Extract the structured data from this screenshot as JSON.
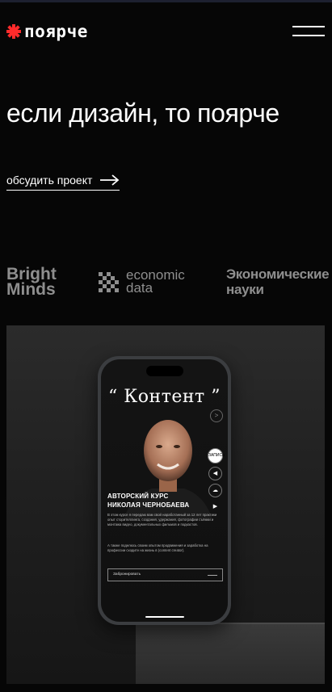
{
  "header": {
    "logo_text": "поярче",
    "accent_color": "#ff2b2b"
  },
  "hero": {
    "title": "если дизайн, то поярче",
    "cta_label": "обсудить проект"
  },
  "clients": {
    "bright_line1": "Bright",
    "bright_line2": "Minds",
    "econ_line1": "economic",
    "econ_line2": "data",
    "nauki_line1": "Экономические",
    "nauki_line2": "науки"
  },
  "showcase": {
    "screen_title": "“ Контент ”",
    "course_title_line1": "АВТОРСКИЙ КУРС",
    "course_title_line2": "НИКОЛАЯ ЧЕРНОБАЕВА",
    "course_text": "В этом курсе я передаю вам свой наработанный за 12 лет практики опыт сторителлинга, создания, удержания, фотографии съёмки и монтажа видео, документальных фильмов и подкастов.",
    "course_text2": "А также поделюсь своим опытом продвижения и заработка на профессии сходите на жизнь в (content creator).",
    "reserve_label": "Забронировать",
    "side_badge": "ЗАПИСЬ"
  }
}
